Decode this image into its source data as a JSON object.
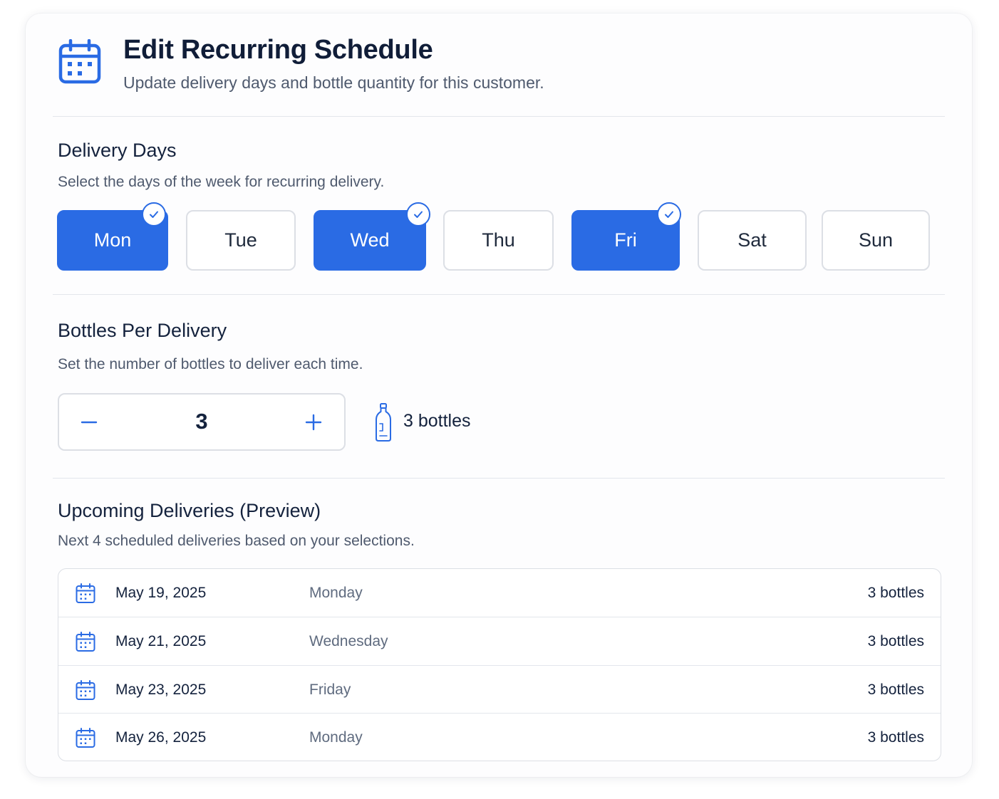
{
  "header": {
    "title": "Edit Recurring Schedule",
    "subtitle": "Update delivery days and bottle quantity for this customer.",
    "icon": "calendar-icon"
  },
  "delivery_days": {
    "title": "Delivery Days",
    "description": "Select the days of the week for recurring delivery.",
    "days": [
      {
        "label": "Mon",
        "selected": true
      },
      {
        "label": "Tue",
        "selected": false
      },
      {
        "label": "Wed",
        "selected": true
      },
      {
        "label": "Thu",
        "selected": false
      },
      {
        "label": "Fri",
        "selected": true
      },
      {
        "label": "Sat",
        "selected": false
      },
      {
        "label": "Sun",
        "selected": false
      }
    ]
  },
  "bottles": {
    "title": "Bottles Per Delivery",
    "description": "Set the number of bottles to deliver each time.",
    "value": "3",
    "decrement_symbol": "−",
    "increment_symbol": "+",
    "summary": "3 bottles",
    "icon": "bottle-icon"
  },
  "upcoming": {
    "title": "Upcoming Deliveries (Preview)",
    "description": "Next 4 scheduled deliveries based on your selections.",
    "rows": [
      {
        "date": "May 19, 2025",
        "weekday": "Monday",
        "qty": "3 bottles"
      },
      {
        "date": "May 21, 2025",
        "weekday": "Wednesday",
        "qty": "3 bottles"
      },
      {
        "date": "May 23, 2025",
        "weekday": "Friday",
        "qty": "3 bottles"
      },
      {
        "date": "May 26, 2025",
        "weekday": "Monday",
        "qty": "3 bottles"
      }
    ]
  },
  "colors": {
    "accent": "#2a6be4",
    "text_primary": "#14223d",
    "text_secondary": "#4f5a6e",
    "border": "#dcdfe5"
  }
}
